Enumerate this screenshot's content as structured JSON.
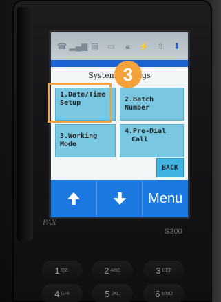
{
  "device": {
    "model": "S300",
    "brand": "PAX"
  },
  "screen": {
    "status_icons": [
      "phone-icon",
      "signal-icon",
      "printer-icon",
      "card-icon",
      "lock-icon",
      "plug-icon",
      "arrow-up-icon",
      "arrow-down-icon"
    ],
    "title": "System Settings",
    "menu": [
      {
        "label_line1": "1.Date/Time",
        "label_line2": "Setup"
      },
      {
        "label_line1": "2.Batch Number",
        "label_line2": ""
      },
      {
        "label_line1": "3.Working Mode",
        "label_line2": ""
      },
      {
        "label_line1": "4.Pre-Dial",
        "label_line2": "Call"
      }
    ],
    "back_label": "BACK",
    "bottom": {
      "menu_label": "Menu"
    }
  },
  "overlay": {
    "step_number": "3",
    "accent_color": "#f5a23a"
  },
  "keypad": [
    {
      "digit": "1",
      "letters": "QZ."
    },
    {
      "digit": "2",
      "letters": "ABC"
    },
    {
      "digit": "3",
      "letters": "DEF"
    },
    {
      "digit": "4",
      "letters": "GHI"
    },
    {
      "digit": "5",
      "letters": "JKL"
    },
    {
      "digit": "6",
      "letters": "MNO"
    }
  ]
}
